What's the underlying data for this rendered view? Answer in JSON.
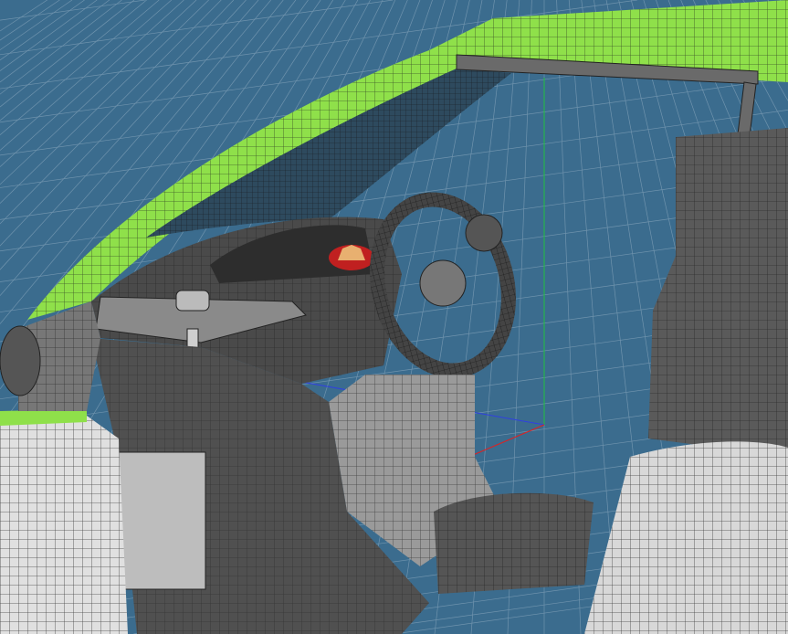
{
  "viewport": {
    "background_color": "#3b6c8e",
    "grid_color": "#6f93ad",
    "axis_colors": {
      "x": "#e02020",
      "y": "#20c040",
      "z": "#3040e0"
    },
    "model": {
      "body_color": "#d8d8d8",
      "roof_accent_color": "#8fe04a",
      "interior_color": "#5a5a5a",
      "wire_color": "#1a1a1a",
      "gauge_color": "#c02020"
    }
  }
}
